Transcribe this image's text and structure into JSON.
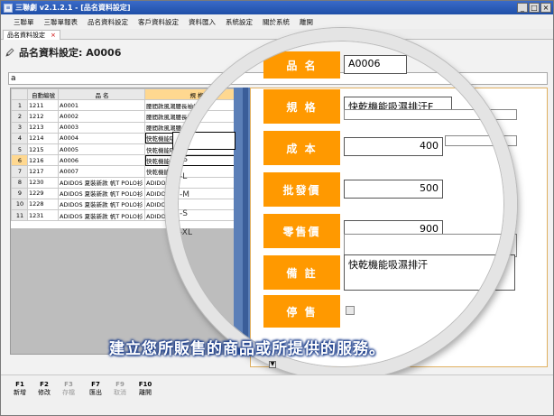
{
  "window": {
    "title": "三聯劇 v2.1.2.1 - [品名資料設定]"
  },
  "menu": [
    "三聯單",
    "三聯單報表",
    "品名資料設定",
    "客戶資料設定",
    "資料匯入",
    "系統設定",
    "關於系統",
    "離開"
  ],
  "doc_tab": {
    "label": "品名資料設定",
    "close": "×"
  },
  "header": {
    "title": "品名資料設定: A0006"
  },
  "search": {
    "value": "a"
  },
  "grid": {
    "columns": [
      "自動編號",
      "品 名",
      "規 格"
    ],
    "rows": [
      {
        "n": "1",
        "id": "1211",
        "name": "A0001",
        "spec": "腰間款風潮腰長袖(深藍"
      },
      {
        "n": "2",
        "id": "1212",
        "name": "A0002",
        "spec": "腰間款風潮腰長袖("
      },
      {
        "n": "3",
        "id": "1213",
        "name": "A0003",
        "spec": "腰間款風潮腰長"
      },
      {
        "n": "4",
        "id": "1214",
        "name": "A0004",
        "spec": "快乾機能吸濕排汗"
      },
      {
        "n": "5",
        "id": "1215",
        "name": "A0005",
        "spec": "快乾機能吸濕"
      },
      {
        "n": "6",
        "id": "1216",
        "name": "A0006",
        "spec": "快乾機能吸"
      },
      {
        "n": "7",
        "id": "1217",
        "name": "A0007",
        "spec": "快乾機能吸"
      },
      {
        "n": "8",
        "id": "1230",
        "name": "ADIDOS 夏裝新款 帆T POLO衫",
        "spec": "ADIDOS 夏"
      },
      {
        "n": "9",
        "id": "1229",
        "name": "ADIDOS 夏裝新款 帆T POLO衫",
        "spec": "ADIDOS 夏"
      },
      {
        "n": "10",
        "id": "1228",
        "name": "ADIDOS 夏裝新款 帆T POLO衫",
        "spec": "ADIDOS 夏"
      },
      {
        "n": "11",
        "id": "1231",
        "name": "ADIDOS 夏裝新款 帆T POLO衫",
        "spec": "ADIDOS 夏"
      }
    ],
    "active_row": 6
  },
  "lens_sizes": [
    "-S",
    "-L",
    "-M",
    "-S",
    "-XL"
  ],
  "form": {
    "name_label": "品 名",
    "name_value": "A0006",
    "spec_label": "規 格",
    "spec_value": "快乾機能吸濕排汗F",
    "cost_label": "成 本",
    "cost_value": "400",
    "wholesale_label": "批發價",
    "wholesale_value": "500",
    "retail_label": "零售價",
    "retail_value": "900",
    "note_label": "備 註",
    "note_value": "快乾機能吸濕排汗",
    "stop_label": "停 售",
    "required_mark": "*"
  },
  "caption": "建立您所販售的商品或所提供的服務。",
  "fkeys": [
    {
      "key": "F1",
      "label": "新增",
      "enabled": true
    },
    {
      "key": "F2",
      "label": "修改",
      "enabled": true
    },
    {
      "key": "F3",
      "label": "存檔",
      "enabled": false
    },
    {
      "key": "F7",
      "label": "匯出",
      "enabled": true
    },
    {
      "key": "F9",
      "label": "取消",
      "enabled": false
    },
    {
      "key": "F10",
      "label": "離開",
      "enabled": true
    }
  ],
  "colors": {
    "title_bar": "#1f4fa8",
    "label_orange": "#ff9900",
    "highlight": "#ffd890",
    "caption_outline": "#1a3c8a"
  }
}
